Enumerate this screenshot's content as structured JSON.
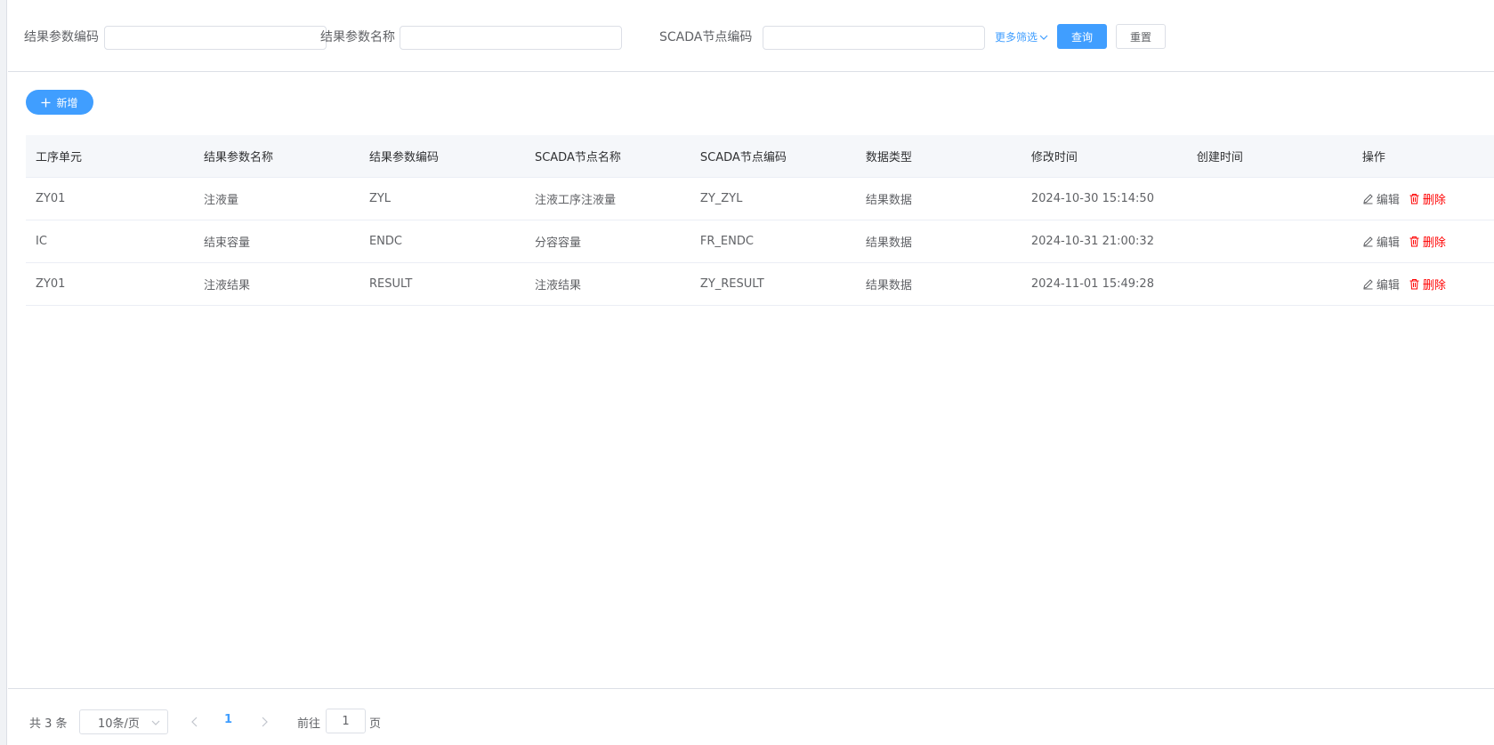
{
  "filters": {
    "code_label": "结果参数编码",
    "name_label": "结果参数名称",
    "scada_label": "SCADA节点编码",
    "more_label": "更多筛选",
    "query_label": "查询",
    "reset_label": "重置"
  },
  "toolbar": {
    "add_label": "新增"
  },
  "table": {
    "headers": [
      "工序单元",
      "结果参数名称",
      "结果参数编码",
      "SCADA节点名称",
      "SCADA节点编码",
      "数据类型",
      "修改时间",
      "创建时间",
      "操作"
    ],
    "rows": [
      [
        "ZY01",
        "注液量",
        "ZYL",
        "注液工序注液量",
        "ZY_ZYL",
        "结果数据",
        "2024-10-30 15:14:50",
        ""
      ],
      [
        "IC",
        "结束容量",
        "ENDC",
        "分容容量",
        "FR_ENDC",
        "结果数据",
        "2024-10-31 21:00:32",
        ""
      ],
      [
        "ZY01",
        "注液结果",
        "RESULT",
        "注液结果",
        "ZY_RESULT",
        "结果数据",
        "2024-11-01 15:49:28",
        ""
      ]
    ],
    "edit_label": "编辑",
    "delete_label": "删除"
  },
  "pagination": {
    "total_text": "共 3 条",
    "page_size": "10条/页",
    "current_page": "1",
    "goto_label": "前往",
    "goto_value": "1",
    "goto_suffix": "页"
  },
  "colors": {
    "primary": "#409eff",
    "danger": "#ff0000"
  },
  "icons": {
    "add": "plus-icon",
    "edit": "pencil-icon",
    "delete": "trash-icon",
    "more": "chevron-down-icon"
  }
}
